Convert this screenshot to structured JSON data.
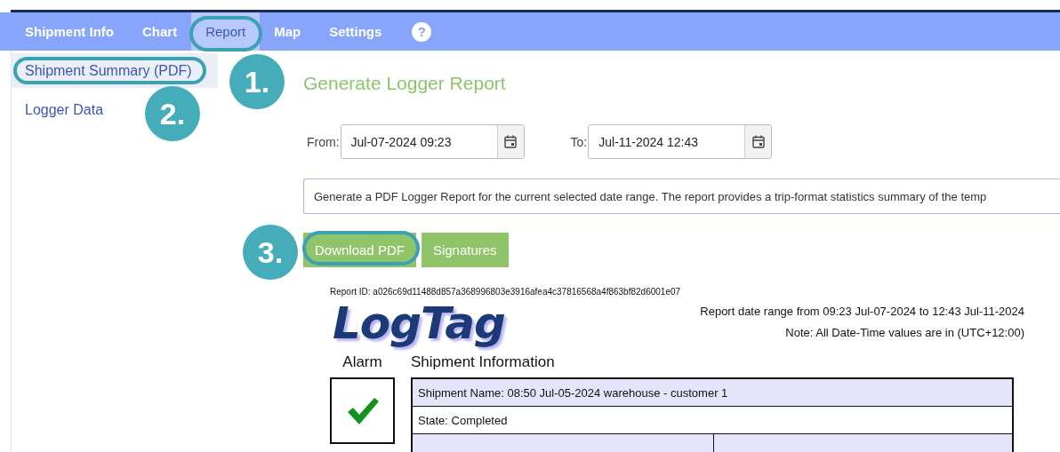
{
  "nav": {
    "tabs": [
      {
        "label": "Shipment Info",
        "selected": false,
        "highlighted": false
      },
      {
        "label": "Chart",
        "selected": false,
        "highlighted": false
      },
      {
        "label": "Report",
        "selected": true,
        "highlighted": true
      },
      {
        "label": "Map",
        "selected": false,
        "highlighted": false
      },
      {
        "label": "Settings",
        "selected": false,
        "highlighted": false
      }
    ],
    "help": "?"
  },
  "sidebar": {
    "items": [
      {
        "label": "Shipment Summary (PDF)",
        "selected": true,
        "highlighted": true
      },
      {
        "label": "Logger Data",
        "selected": false,
        "highlighted": false
      }
    ]
  },
  "callouts": [
    {
      "label": "1."
    },
    {
      "label": "2."
    },
    {
      "label": "3."
    }
  ],
  "heading": "Generate Logger Report",
  "date_range": [
    {
      "label": "From:",
      "value": "Jul-07-2024 09:23"
    },
    {
      "label": "To:",
      "value": "Jul-11-2024 12:43"
    }
  ],
  "description": "Generate a PDF Logger Report for the current selected date range. The report provides a trip-format statistics summary of the temp",
  "buttons": [
    {
      "label": "Download PDF",
      "highlighted": true
    },
    {
      "label": "Signatures",
      "highlighted": false
    }
  ],
  "report": {
    "report_id": "Report ID: a026c69d11488d857a368996803e3916afea4c37816568a4f863bf82d6001e07",
    "logo": "LogTag",
    "range_text": "Report date range from 09:23 Jul-07-2024 to 12:43 Jul-11-2024",
    "note": "Note: All Date-Time values are in (UTC+12:00)",
    "alarm_label": "Alarm",
    "alarm_ok": true,
    "section_title": "Shipment Information",
    "rows": [
      {
        "text": "Shipment Name: 08:50 Jul-05-2024 warehouse - customer 1",
        "shaded": true
      },
      {
        "text": "State: Completed",
        "shaded": false
      }
    ]
  }
}
